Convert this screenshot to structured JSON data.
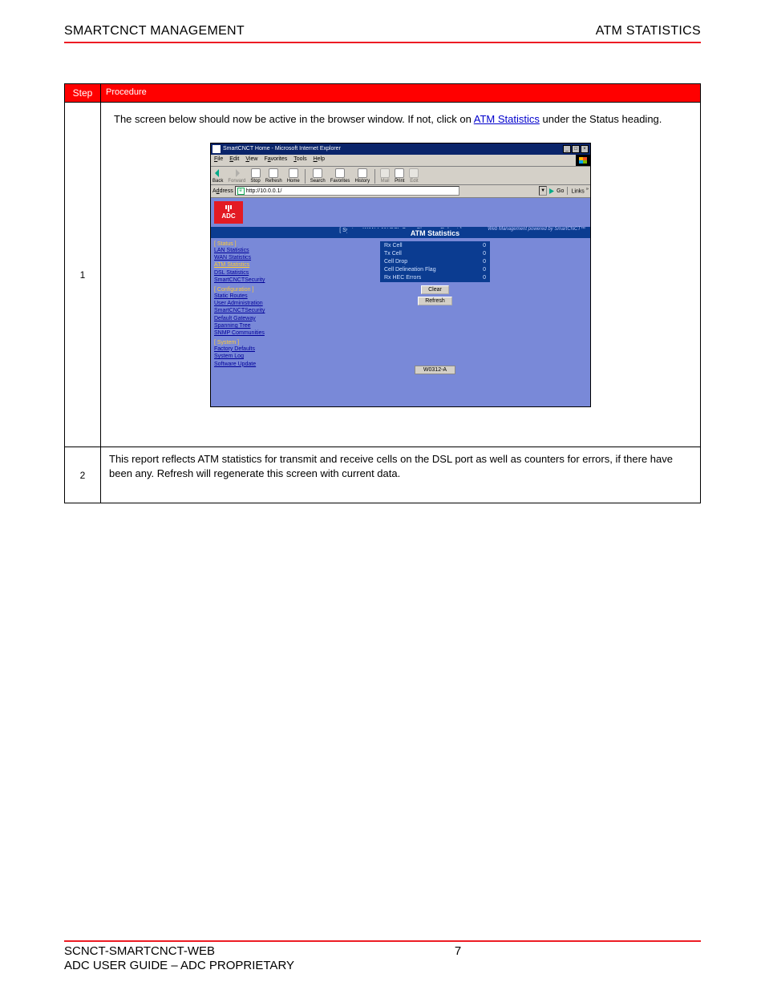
{
  "outer_table": {
    "headers": {
      "step": "Step",
      "procedure": "Procedure"
    },
    "rows": {
      "r1": {
        "step": "1",
        "instruction_prefix": "The screen below should now be active in the browser window. If not, click on",
        "instruction_link": " ATM Statistics",
        "instruction_suffix": " under the Status heading."
      },
      "r2": {
        "step": "2",
        "instruction": "This report reflects ATM statistics for transmit and receive cells on the DSL port as well as counters for errors, if there have been any. Refresh will regenerate this screen with current data."
      }
    }
  },
  "browser": {
    "title": "SmartCNCT Home - Microsoft Internet Explorer",
    "menus": [
      "File",
      "Edit",
      "View",
      "Favorites",
      "Tools",
      "Help"
    ],
    "toolbar": {
      "back": "Back",
      "forward": "Forward",
      "stop": "Stop",
      "refresh": "Refresh",
      "home": "Home",
      "search": "Search",
      "favorites": "Favorites",
      "history": "History",
      "mail": "Mail",
      "print": "Print",
      "edit": "Edit"
    },
    "address_label": "Address",
    "address_value": "http://10.0.0.1/",
    "go": "Go",
    "links": "Links",
    "adc_logo": "ADC",
    "tagline": "Web Management powered by SmartCNCT™",
    "topnav": "[ System  WAN  LAN  DSL  Save Changes  Reboot ]",
    "panel_title": "ATM Statistics",
    "figlabel": "W0312-A"
  },
  "leftnav": {
    "status_section": "[ Status ]",
    "status_items": [
      "LAN Statistics",
      "WAN Statistics",
      "ATM Statistics",
      "DSL Statistics",
      "SmartCNCTSecurity"
    ],
    "config_section": "[ Configuration ]",
    "config_items": [
      "Static Routes",
      "User Administration",
      "SmartCNCTSecurity",
      "Default Gateway",
      "Spanning Tree",
      "SNMP Communities"
    ],
    "system_section": "[ System ]",
    "system_items": [
      "Factory Defaults",
      "System Log",
      "Software Update"
    ]
  },
  "stats": {
    "rows": [
      {
        "label": "Rx Cell",
        "value": "0"
      },
      {
        "label": "Tx Cell",
        "value": "0"
      },
      {
        "label": "Cell Drop",
        "value": "0"
      },
      {
        "label": "Cell Delineation Flag",
        "value": "0"
      },
      {
        "label": "Rx HEC Errors",
        "value": "0"
      }
    ],
    "buttons": {
      "clear": "Clear",
      "refresh": "Refresh"
    }
  },
  "header": {
    "left": "SMARTCNCT MANAGEMENT",
    "right": "ATM STATISTICS"
  },
  "footer": {
    "left": "SCNCT-SMARTCNCT-WEB",
    "center": "7",
    "guide": "ADC USER GUIDE – ADC PROPRIETARY"
  }
}
